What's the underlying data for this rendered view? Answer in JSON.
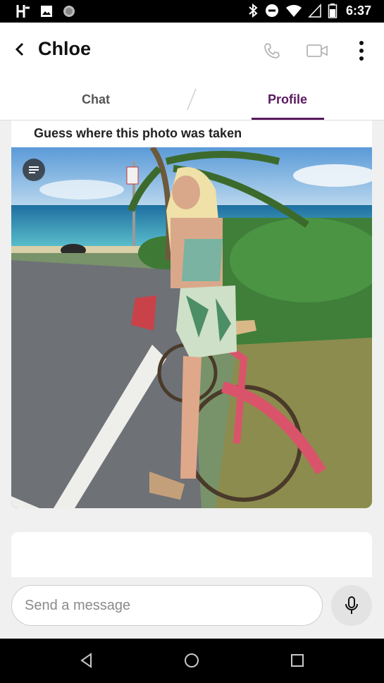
{
  "status_bar": {
    "time": "6:37",
    "icons": [
      "hinge-h-icon",
      "image-icon",
      "circle-icon",
      "bluetooth-icon",
      "do-not-disturb-icon",
      "wifi-icon",
      "signal-icon",
      "battery-icon"
    ]
  },
  "header": {
    "title": "Chloe",
    "actions": [
      "phone-icon",
      "video-icon",
      "more-vert-icon"
    ]
  },
  "tabs": [
    {
      "label": "Chat",
      "active": false
    },
    {
      "label": "Profile",
      "active": true
    }
  ],
  "profile": {
    "prompt": "Guess where this photo was taken",
    "photo_overlay_icon": "notes-icon"
  },
  "composer": {
    "placeholder": "Send a message",
    "mic_icon": "mic-icon"
  },
  "nav": [
    "back-triangle-icon",
    "home-circle-icon",
    "recents-square-icon"
  ],
  "colors": {
    "accent": "#5a1a5e",
    "status_bar": "#000000",
    "background": "#f0f0f0"
  }
}
